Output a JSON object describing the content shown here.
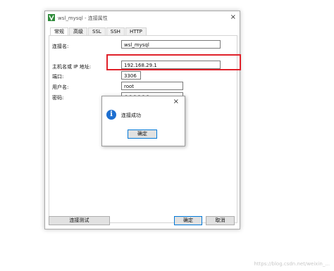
{
  "window": {
    "title": "wsl_mysql - 连接属性",
    "close_glyph": "×"
  },
  "tabs": [
    {
      "label": "常规",
      "active": true
    },
    {
      "label": "高级",
      "active": false
    },
    {
      "label": "SSL",
      "active": false
    },
    {
      "label": "SSH",
      "active": false
    },
    {
      "label": "HTTP",
      "active": false
    }
  ],
  "form": {
    "connection_name_label": "连接名:",
    "connection_name_value": "wsl_mysql",
    "host_label": "主机名或 IP 地址:",
    "host_value": "192.168.29.1",
    "port_label": "端口:",
    "port_value": "3306",
    "user_label": "用户名:",
    "user_value": "root",
    "password_label": "密码:",
    "password_value": "●●●●●●"
  },
  "buttons": {
    "test": "连接测试",
    "ok": "确定",
    "cancel": "取消"
  },
  "message_box": {
    "text": "连接成功",
    "ok": "确定",
    "close_glyph": "×",
    "icon_glyph": "i"
  },
  "watermark": "https://blog.csdn.net/weixin_..."
}
